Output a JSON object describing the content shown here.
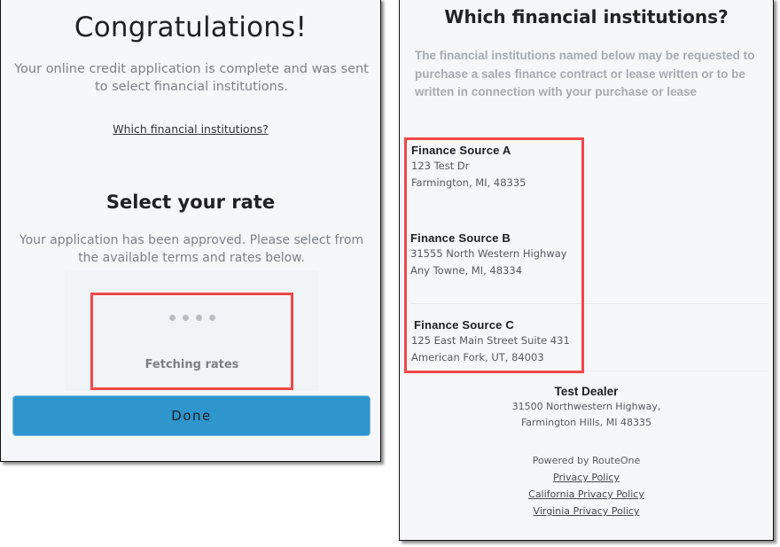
{
  "left_panel": {
    "title": "Congratulations!",
    "description": "Your online credit application is complete and was sent to select financial institutions.",
    "which_link": "Which financial institutions?",
    "rate_title": "Select your rate",
    "rate_description": "Your application has been approved. Please select from the available terms and rates below.",
    "loading": {
      "dot_count": 4,
      "status": "Fetching rates"
    },
    "done_button": "Done"
  },
  "right_panel": {
    "title": "Which financial institutions?",
    "description": "The financial institutions named below may be requested to purchase a sales finance contract or lease written or to be written in connection with your purchase or lease",
    "finance_sources": [
      {
        "name": "Finance Source A",
        "address1": "123 Test Dr",
        "address2": "Farmington, MI, 48335"
      },
      {
        "name": "Finance Source B",
        "address1": "31555 North Western Highway",
        "address2": "Any Towne, MI, 48334"
      },
      {
        "name": "Finance Source C",
        "address1": "125 East Main Street Suite 431",
        "address2": "American Fork, UT, 84003"
      }
    ],
    "dealer": {
      "name": "Test Dealer",
      "address1": "31500 Northwestern Highway,",
      "address2": "Farmington Hills, MI 48335"
    },
    "footer": {
      "powered_by": "Powered by RouteOne",
      "links": [
        "Privacy Policy",
        "California Privacy Policy",
        "Virginia Privacy Policy"
      ]
    }
  },
  "colors": {
    "primary_button": "#2f95cd",
    "highlight": "#ef4848",
    "panel_background": "#f6f7f9"
  }
}
